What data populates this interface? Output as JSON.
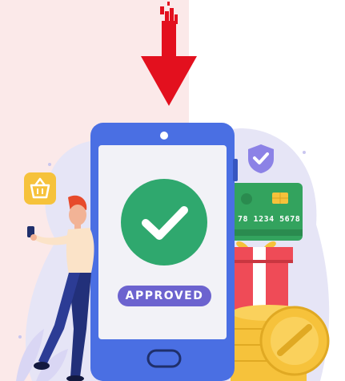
{
  "status": {
    "label": "APPROVED"
  },
  "card": {
    "number_fragment": "78 1234 5678"
  },
  "colors": {
    "background_panel": "#fbe9e9",
    "arrow": "#e3101e",
    "phone_body": "#4a6fe3",
    "phone_screen": "#f2f2f7",
    "approved_circle": "#2fa86e",
    "approved_badge": "#6c63cf",
    "card": "#33a35e",
    "gift_box": "#ef4b57",
    "coin": "#f6c23b",
    "shield": "#8c82e6",
    "basket_badge": "#f6c23b"
  },
  "icons": [
    "download-arrow-icon",
    "checkmark-icon",
    "shield-check-icon",
    "shopping-basket-icon",
    "credit-card-icon",
    "gift-box-icon",
    "coin-stack-icon"
  ]
}
